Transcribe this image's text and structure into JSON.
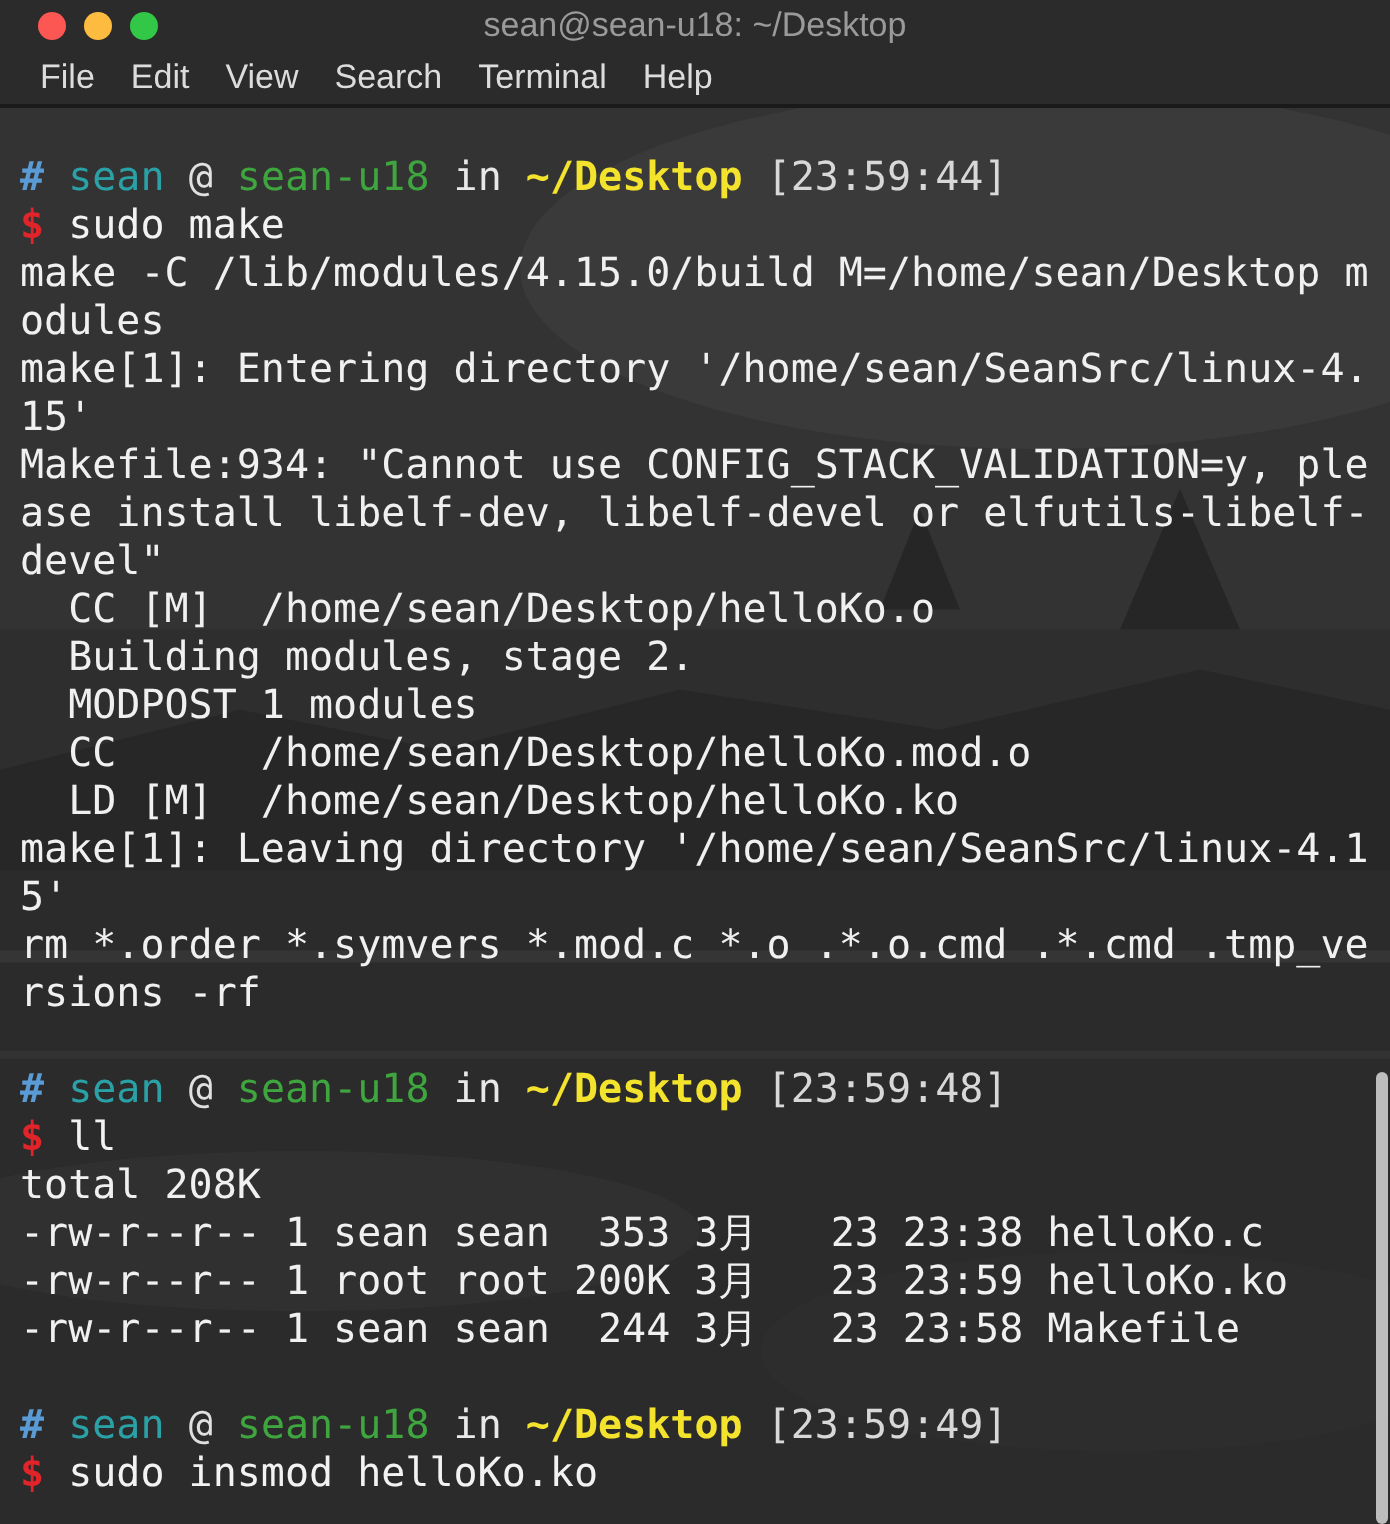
{
  "window": {
    "title": "sean@sean-u18: ~/Desktop"
  },
  "menu": [
    "File",
    "Edit",
    "View",
    "Search",
    "Terminal",
    "Help"
  ],
  "terminal": {
    "lines": [
      {
        "kind": "prompt",
        "hash": "#",
        "user": "sean",
        "at": "@",
        "host": "sean-u18",
        "in": "in",
        "dir": "~/Desktop",
        "time": "[23:59:44]"
      },
      {
        "kind": "command",
        "sign": "$",
        "text": "sudo make"
      },
      {
        "kind": "output",
        "text": "make -C /lib/modules/4.15.0/build M=/home/sean/Desktop m"
      },
      {
        "kind": "output",
        "text": "odules"
      },
      {
        "kind": "output",
        "text": "make[1]: Entering directory '/home/sean/SeanSrc/linux-4."
      },
      {
        "kind": "output",
        "text": "15'"
      },
      {
        "kind": "output",
        "text": "Makefile:934: \"Cannot use CONFIG_STACK_VALIDATION=y, ple"
      },
      {
        "kind": "output",
        "text": "ase install libelf-dev, libelf-devel or elfutils-libelf-"
      },
      {
        "kind": "output",
        "text": "devel\""
      },
      {
        "kind": "output",
        "text": "  CC [M]  /home/sean/Desktop/helloKo.o"
      },
      {
        "kind": "output",
        "text": "  Building modules, stage 2."
      },
      {
        "kind": "output",
        "text": "  MODPOST 1 modules"
      },
      {
        "kind": "output",
        "text": "  CC      /home/sean/Desktop/helloKo.mod.o"
      },
      {
        "kind": "output",
        "text": "  LD [M]  /home/sean/Desktop/helloKo.ko"
      },
      {
        "kind": "output",
        "text": "make[1]: Leaving directory '/home/sean/SeanSrc/linux-4.1"
      },
      {
        "kind": "output",
        "text": "5'"
      },
      {
        "kind": "output",
        "text": "rm *.order *.symvers *.mod.c *.o .*.o.cmd .*.cmd .tmp_ve"
      },
      {
        "kind": "output",
        "text": "rsions -rf"
      },
      {
        "kind": "blank"
      },
      {
        "kind": "prompt",
        "hash": "#",
        "user": "sean",
        "at": "@",
        "host": "sean-u18",
        "in": "in",
        "dir": "~/Desktop",
        "time": "[23:59:48]"
      },
      {
        "kind": "command",
        "sign": "$",
        "text": "ll"
      },
      {
        "kind": "output",
        "text": "total 208K"
      },
      {
        "kind": "output",
        "text": "-rw-r--r-- 1 sean sean  353 3月   23 23:38 helloKo.c"
      },
      {
        "kind": "output",
        "text": "-rw-r--r-- 1 root root 200K 3月   23 23:59 helloKo.ko"
      },
      {
        "kind": "output",
        "text": "-rw-r--r-- 1 sean sean  244 3月   23 23:58 Makefile"
      },
      {
        "kind": "blank"
      },
      {
        "kind": "prompt",
        "hash": "#",
        "user": "sean",
        "at": "@",
        "host": "sean-u18",
        "in": "in",
        "dir": "~/Desktop",
        "time": "[23:59:49]"
      },
      {
        "kind": "command",
        "sign": "$",
        "text": "sudo insmod helloKo.ko"
      }
    ]
  }
}
